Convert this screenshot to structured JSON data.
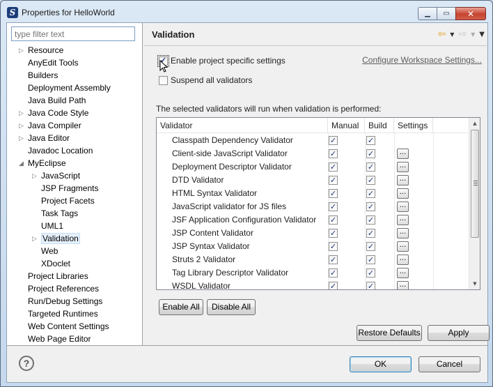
{
  "window": {
    "title": "Properties for HelloWorld",
    "min_glyph": "▁",
    "max_glyph": "▭",
    "close_glyph": "✕",
    "app_icon_glyph": "S"
  },
  "filter": {
    "placeholder": "type filter text"
  },
  "tree": [
    {
      "label": "Resource",
      "level": 0,
      "expander": "collapsed"
    },
    {
      "label": "AnyEdit Tools",
      "level": 0,
      "expander": "none"
    },
    {
      "label": "Builders",
      "level": 0,
      "expander": "none"
    },
    {
      "label": "Deployment Assembly",
      "level": 0,
      "expander": "none"
    },
    {
      "label": "Java Build Path",
      "level": 0,
      "expander": "none"
    },
    {
      "label": "Java Code Style",
      "level": 0,
      "expander": "collapsed"
    },
    {
      "label": "Java Compiler",
      "level": 0,
      "expander": "collapsed"
    },
    {
      "label": "Java Editor",
      "level": 0,
      "expander": "collapsed"
    },
    {
      "label": "Javadoc Location",
      "level": 0,
      "expander": "none"
    },
    {
      "label": "MyEclipse",
      "level": 0,
      "expander": "expanded"
    },
    {
      "label": "JavaScript",
      "level": 1,
      "expander": "collapsed"
    },
    {
      "label": "JSP Fragments",
      "level": 1,
      "expander": "none"
    },
    {
      "label": "Project Facets",
      "level": 1,
      "expander": "none"
    },
    {
      "label": "Task Tags",
      "level": 1,
      "expander": "none"
    },
    {
      "label": "UML1",
      "level": 1,
      "expander": "none"
    },
    {
      "label": "Validation",
      "level": 1,
      "expander": "collapsed",
      "selected": true
    },
    {
      "label": "Web",
      "level": 1,
      "expander": "none"
    },
    {
      "label": "XDoclet",
      "level": 1,
      "expander": "none"
    },
    {
      "label": "Project Libraries",
      "level": 0,
      "expander": "none"
    },
    {
      "label": "Project References",
      "level": 0,
      "expander": "none"
    },
    {
      "label": "Run/Debug Settings",
      "level": 0,
      "expander": "none"
    },
    {
      "label": "Targeted Runtimes",
      "level": 0,
      "expander": "none"
    },
    {
      "label": "Web Content Settings",
      "level": 0,
      "expander": "none"
    },
    {
      "label": "Web Page Editor",
      "level": 0,
      "expander": "none"
    }
  ],
  "page": {
    "title": "Validation",
    "enable_specific": {
      "label": "Enable project specific settings",
      "checked": true
    },
    "configure_link": "Configure Workspace Settings...",
    "suspend_all": {
      "label": "Suspend all validators",
      "checked": false
    },
    "caption": "The selected validators will run when validation is performed:"
  },
  "table": {
    "columns": [
      "Validator",
      "Manual",
      "Build",
      "Settings"
    ],
    "rows": [
      {
        "name": "Classpath Dependency Validator",
        "manual": true,
        "build": true,
        "settings": false
      },
      {
        "name": "Client-side JavaScript Validator",
        "manual": true,
        "build": true,
        "settings": true
      },
      {
        "name": "Deployment Descriptor Validator",
        "manual": true,
        "build": true,
        "settings": true
      },
      {
        "name": "DTD Validator",
        "manual": true,
        "build": true,
        "settings": true
      },
      {
        "name": "HTML Syntax Validator",
        "manual": true,
        "build": true,
        "settings": true
      },
      {
        "name": "JavaScript validator for JS files",
        "manual": true,
        "build": true,
        "settings": true
      },
      {
        "name": "JSF Application Configuration Validator",
        "manual": true,
        "build": true,
        "settings": true
      },
      {
        "name": "JSP Content Validator",
        "manual": true,
        "build": true,
        "settings": true
      },
      {
        "name": "JSP Syntax Validator",
        "manual": true,
        "build": true,
        "settings": true
      },
      {
        "name": "Struts 2 Validator",
        "manual": true,
        "build": true,
        "settings": true
      },
      {
        "name": "Tag Library Descriptor Validator",
        "manual": true,
        "build": true,
        "settings": true
      },
      {
        "name": "WSDL Validator",
        "manual": true,
        "build": true,
        "settings": true
      }
    ],
    "settings_glyph": "...",
    "check_glyph": "✓"
  },
  "buttons": {
    "enable_all": "Enable All",
    "disable_all": "Disable All",
    "restore_defaults": "Restore Defaults",
    "apply": "Apply",
    "ok": "OK",
    "cancel": "Cancel",
    "help_glyph": "?"
  },
  "nav": {
    "back_glyph": "⇦",
    "forward_glyph": "⇨",
    "dropdown_glyph": "▼",
    "menu_glyph": "▼"
  },
  "icons": {
    "expander_collapsed": "▷",
    "expander_expanded": "◢",
    "scroll_up": "▲",
    "scroll_down": "▼"
  },
  "colors": {
    "selection": "#e5f0fb",
    "link": "#5c5c5c",
    "check": "#22357a"
  }
}
